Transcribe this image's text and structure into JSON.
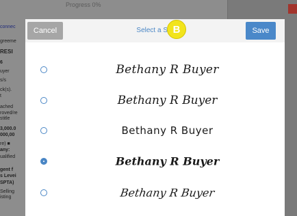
{
  "background": {
    "progress_text": "Progress 0%",
    "left_lines": [
      "connec",
      "greeme",
      "RESI",
      "6",
      "uyer",
      "s/s",
      "ck(s).",
      "t",
      "ached",
      "roved/re",
      "stitle",
      "3,000.0",
      "000,00",
      "re) ■",
      "any:",
      "ualified",
      "gent f",
      "s Levei",
      "SPTA)",
      "Selling",
      "isting"
    ]
  },
  "modal": {
    "cancel_label": "Cancel",
    "title": "Select a Style",
    "badge": "B",
    "save_label": "Save",
    "options": [
      {
        "text": "Bethany R Buyer",
        "selected": false
      },
      {
        "text": "Bethany R Buyer",
        "selected": false
      },
      {
        "text": "Bethany R Buyer",
        "selected": false
      },
      {
        "text": "Bethany R Buyer",
        "selected": true
      },
      {
        "text": "Bethany R Buyer",
        "selected": false
      }
    ]
  },
  "colors": {
    "accent": "#4a86c5",
    "save": "#4a88c9",
    "cancel": "#a6a6a6",
    "badge": "#f2e41c"
  }
}
